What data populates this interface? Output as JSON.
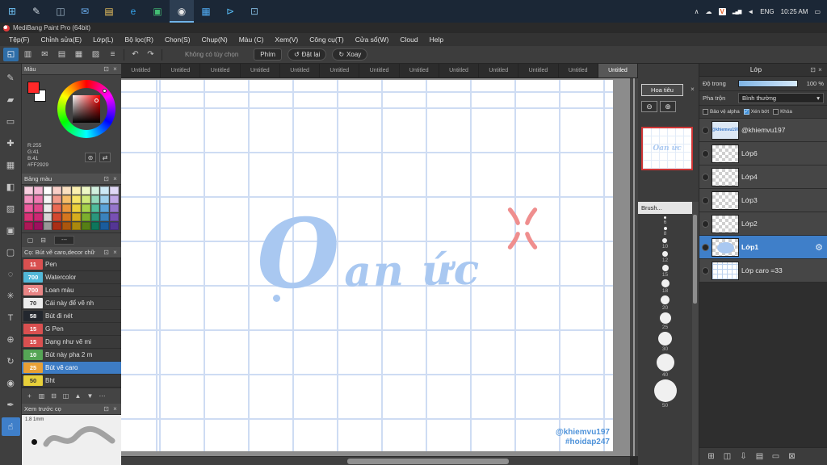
{
  "icons": {
    "close": "×",
    "dock": "⊡",
    "undo": "↶",
    "redo": "↷",
    "zoom_out": "⊖",
    "zoom_in": "⊕",
    "caret_down": "▾",
    "gear": "⚙",
    "reset": "↺",
    "rotate": "↻",
    "globe": "⊚",
    "swap": "⇄",
    "new_swatch": "▢",
    "delete_swatch": "⊟"
  },
  "taskbar": {
    "apps": [
      {
        "name": "start-button",
        "glyph": "⊞",
        "color": "#6fc3f7"
      },
      {
        "name": "search-app-icon",
        "glyph": "✎",
        "color": "#cfd8e0"
      },
      {
        "name": "taskview-app-icon",
        "glyph": "◫",
        "color": "#9fb6c8"
      },
      {
        "name": "mail-app-icon",
        "glyph": "✉",
        "color": "#6aaef0"
      },
      {
        "name": "explorer-app-icon",
        "glyph": "▤",
        "color": "#eec45e"
      },
      {
        "name": "edge-app-icon",
        "glyph": "e",
        "color": "#35a3ea"
      },
      {
        "name": "store-app-icon",
        "glyph": "▣",
        "color": "#43bd74"
      },
      {
        "name": "chrome-app-icon",
        "glyph": "◉",
        "color": "#e8e8e8",
        "active": true
      },
      {
        "name": "photos-app-icon",
        "glyph": "▦",
        "color": "#4fa8ee"
      },
      {
        "name": "code-app-icon",
        "glyph": "⊳",
        "color": "#55b8f0"
      },
      {
        "name": "settings-app-icon",
        "glyph": "⊡",
        "color": "#7fb4d8"
      }
    ],
    "tray": {
      "chevron": "∧",
      "cloud": "☁",
      "vlc": "V",
      "net": "▂▄▆",
      "vol": "◄",
      "lang": "ENG",
      "time": "10:25 AM",
      "notif": "▭"
    }
  },
  "window": {
    "title": "MediBang Paint Pro (64bit)"
  },
  "menu": [
    "Tệp(F)",
    "Chỉnh sửa(E)",
    "Lớp(L)",
    "Bộ lọc(R)",
    "Chọn(S)",
    "Chụp(N)",
    "Màu (C)",
    "Xem(V)",
    "Công cụ(T)",
    "Cửa sổ(W)",
    "Cloud",
    "Help"
  ],
  "toolbar": {
    "icons": [
      {
        "name": "transform-tool-icon",
        "glyph": "◱",
        "active": true
      },
      {
        "name": "save-icon",
        "glyph": "▥"
      },
      {
        "name": "comment-icon",
        "glyph": "✉"
      },
      {
        "name": "panel-layout-1-icon",
        "glyph": "▤"
      },
      {
        "name": "panel-layout-2-icon",
        "glyph": "▦"
      },
      {
        "name": "panel-layout-3-icon",
        "glyph": "▨"
      },
      {
        "name": "menu-icon",
        "glyph": "≡"
      }
    ],
    "no_option": "Không có tùy chọn",
    "phim": "Phím",
    "dat_lai": "Đặt lại",
    "xoay": "Xoay"
  },
  "tools": [
    {
      "name": "brush-tool-icon",
      "glyph": "✎"
    },
    {
      "name": "eraser-tool-icon",
      "glyph": "▰"
    },
    {
      "name": "select-tool-icon",
      "glyph": "▭"
    },
    {
      "name": "move-tool-icon",
      "glyph": "✚"
    },
    {
      "name": "grid-tool-icon",
      "glyph": "▦"
    },
    {
      "name": "fill-tool-icon",
      "glyph": "◧"
    },
    {
      "name": "gradient-tool-icon",
      "glyph": "▨"
    },
    {
      "name": "shape-tool-icon",
      "glyph": "▣"
    },
    {
      "name": "marquee-tool-icon",
      "glyph": "▢"
    },
    {
      "name": "lasso-tool-icon",
      "glyph": "◌"
    },
    {
      "name": "wand-tool-icon",
      "glyph": "✳"
    },
    {
      "name": "text-tool-icon",
      "glyph": "T"
    },
    {
      "name": "picker-tool-icon",
      "glyph": "⊕"
    },
    {
      "name": "rotate-tool-icon",
      "glyph": "↻"
    },
    {
      "name": "eyedropper-tool-icon",
      "glyph": "◉"
    },
    {
      "name": "pen-tool-icon",
      "glyph": "✒"
    },
    {
      "name": "hand-tool-icon",
      "glyph": "☝",
      "active": true
    }
  ],
  "tabs": {
    "items": [
      "Untitled",
      "Untitled",
      "Untitled",
      "Untitled",
      "Untitled",
      "Untitled",
      "Untitled",
      "Untitled",
      "Untitled",
      "Untitled",
      "Untitled",
      "Untitled",
      "Untitled"
    ],
    "active_index": 12
  },
  "color": {
    "title": "Màu",
    "fg": "#ff2929",
    "bg": "#ffffff",
    "r": "R:255",
    "g": "G:41",
    "b": "B:41",
    "hex": "#FF2929"
  },
  "palette": {
    "title": "Bảng màu",
    "preset": "---",
    "colors": [
      "#f9cfe0",
      "#f4b8d4",
      "#ffffff",
      "#f8cfc8",
      "#fae0c0",
      "#fbf0b0",
      "#eef8c6",
      "#d2f0df",
      "#cde9f6",
      "#e0d8f6",
      "#f293c0",
      "#ee7cb2",
      "#f6f6f6",
      "#f09a8a",
      "#f5bd6a",
      "#f6e468",
      "#cfe87a",
      "#92d8bc",
      "#9ccfec",
      "#bfa6e6",
      "#ec5b9e",
      "#e0488c",
      "#ececec",
      "#ea6a54",
      "#eb953c",
      "#ecd03c",
      "#a6d24c",
      "#50bc9c",
      "#5ca4da",
      "#9676cc",
      "#d83276",
      "#cc2874",
      "#d6d6d6",
      "#d44830",
      "#d4761f",
      "#d4ac1f",
      "#7cae2e",
      "#2a967c",
      "#3a82bc",
      "#7850b4",
      "#ac1856",
      "#9c105e",
      "#989898",
      "#aa2e16",
      "#aa560e",
      "#aa880e",
      "#567f16",
      "#0e765c",
      "#1a5c9c",
      "#543694"
    ]
  },
  "brushes": {
    "title": "Cọ: Bút vẽ caro,decor chữ",
    "items": [
      {
        "size": "11",
        "name": "Pen",
        "color": "#d95050",
        "tc": "#ffffff"
      },
      {
        "size": "700",
        "name": "Watercolor",
        "color": "#52b8d8",
        "tc": "#ffffff"
      },
      {
        "size": "700",
        "name": "Loan màu",
        "color": "#e98585",
        "tc": "#ffffff"
      },
      {
        "size": "70",
        "name": "Cái này để vẽ nh",
        "color": "#ececec",
        "tc": "#333333"
      },
      {
        "size": "58",
        "name": "Bút đi nét",
        "color": "#23272e",
        "tc": "#ffffff"
      },
      {
        "size": "15",
        "name": "G Pen",
        "color": "#d95050",
        "tc": "#ffffff"
      },
      {
        "size": "15",
        "name": "Dạng như vẽ mi",
        "color": "#d95050",
        "tc": "#ffffff"
      },
      {
        "size": "10",
        "name": "Bút này pha 2 m",
        "color": "#55a555",
        "tc": "#ffffff"
      },
      {
        "size": "25",
        "name": "Bút vẽ caro",
        "color": "#e8a035",
        "tc": "#ffffff",
        "selected": true
      },
      {
        "size": "50",
        "name": "Bht",
        "color": "#e8d03a",
        "tc": "#333333"
      }
    ],
    "actions": [
      {
        "name": "add-brush-button",
        "glyph": "+"
      },
      {
        "name": "brush-folder-button",
        "glyph": "▥"
      },
      {
        "name": "delete-brush-button",
        "glyph": "⊟"
      },
      {
        "name": "duplicate-brush-button",
        "glyph": "◫"
      },
      {
        "name": "brush-up-button",
        "glyph": "▲"
      },
      {
        "name": "brush-down-button",
        "glyph": "▼"
      },
      {
        "name": "brush-settings-button",
        "glyph": "⋯"
      }
    ]
  },
  "preview": {
    "title": "Xem trước cọ",
    "label": "1.8 1mm"
  },
  "canvas": {
    "text": "Oan ức",
    "text_initial": "O",
    "text_rest": "an ức",
    "watermark1": "@khiemvu197",
    "watermark2": "#hoidap247"
  },
  "navigator": {
    "title": "Hoa tiêu"
  },
  "brush_sizes": {
    "title": "Brush...",
    "sizes": [
      6,
      8,
      10,
      12,
      15,
      18,
      20,
      25,
      30,
      40,
      50
    ]
  },
  "layers": {
    "title": "Lớp",
    "opacity_label": "Độ trong",
    "opacity_value": "100 %",
    "blend_label": "Pha trộn",
    "blend_value": "Bình thường",
    "checks": [
      {
        "key": "alpha",
        "label": "Bảo vệ alpha",
        "checked": false
      },
      {
        "key": "clip",
        "label": "Xén bớt",
        "checked": true
      },
      {
        "key": "lock",
        "label": "Khóa",
        "checked": false
      }
    ],
    "items": [
      {
        "name": "@khiemvu197",
        "thumb": "text"
      },
      {
        "name": "Lớp6",
        "thumb": "checker"
      },
      {
        "name": "Lớp4",
        "thumb": "checker"
      },
      {
        "name": "Lớp3",
        "thumb": "checker"
      },
      {
        "name": "Lớp2",
        "thumb": "checker"
      },
      {
        "name": "Lớp1",
        "thumb": "paint",
        "selected": true
      },
      {
        "name": "Lớp caro =33",
        "thumb": "caro"
      }
    ],
    "actions": [
      {
        "name": "add-layer-button",
        "glyph": "⊞"
      },
      {
        "name": "duplicate-layer-button",
        "glyph": "◫"
      },
      {
        "name": "merge-down-button",
        "glyph": "⇩"
      },
      {
        "name": "layer-list-button",
        "glyph": "▤"
      },
      {
        "name": "new-folder-button",
        "glyph": "▭"
      },
      {
        "name": "delete-layer-button",
        "glyph": "⊠"
      }
    ]
  }
}
